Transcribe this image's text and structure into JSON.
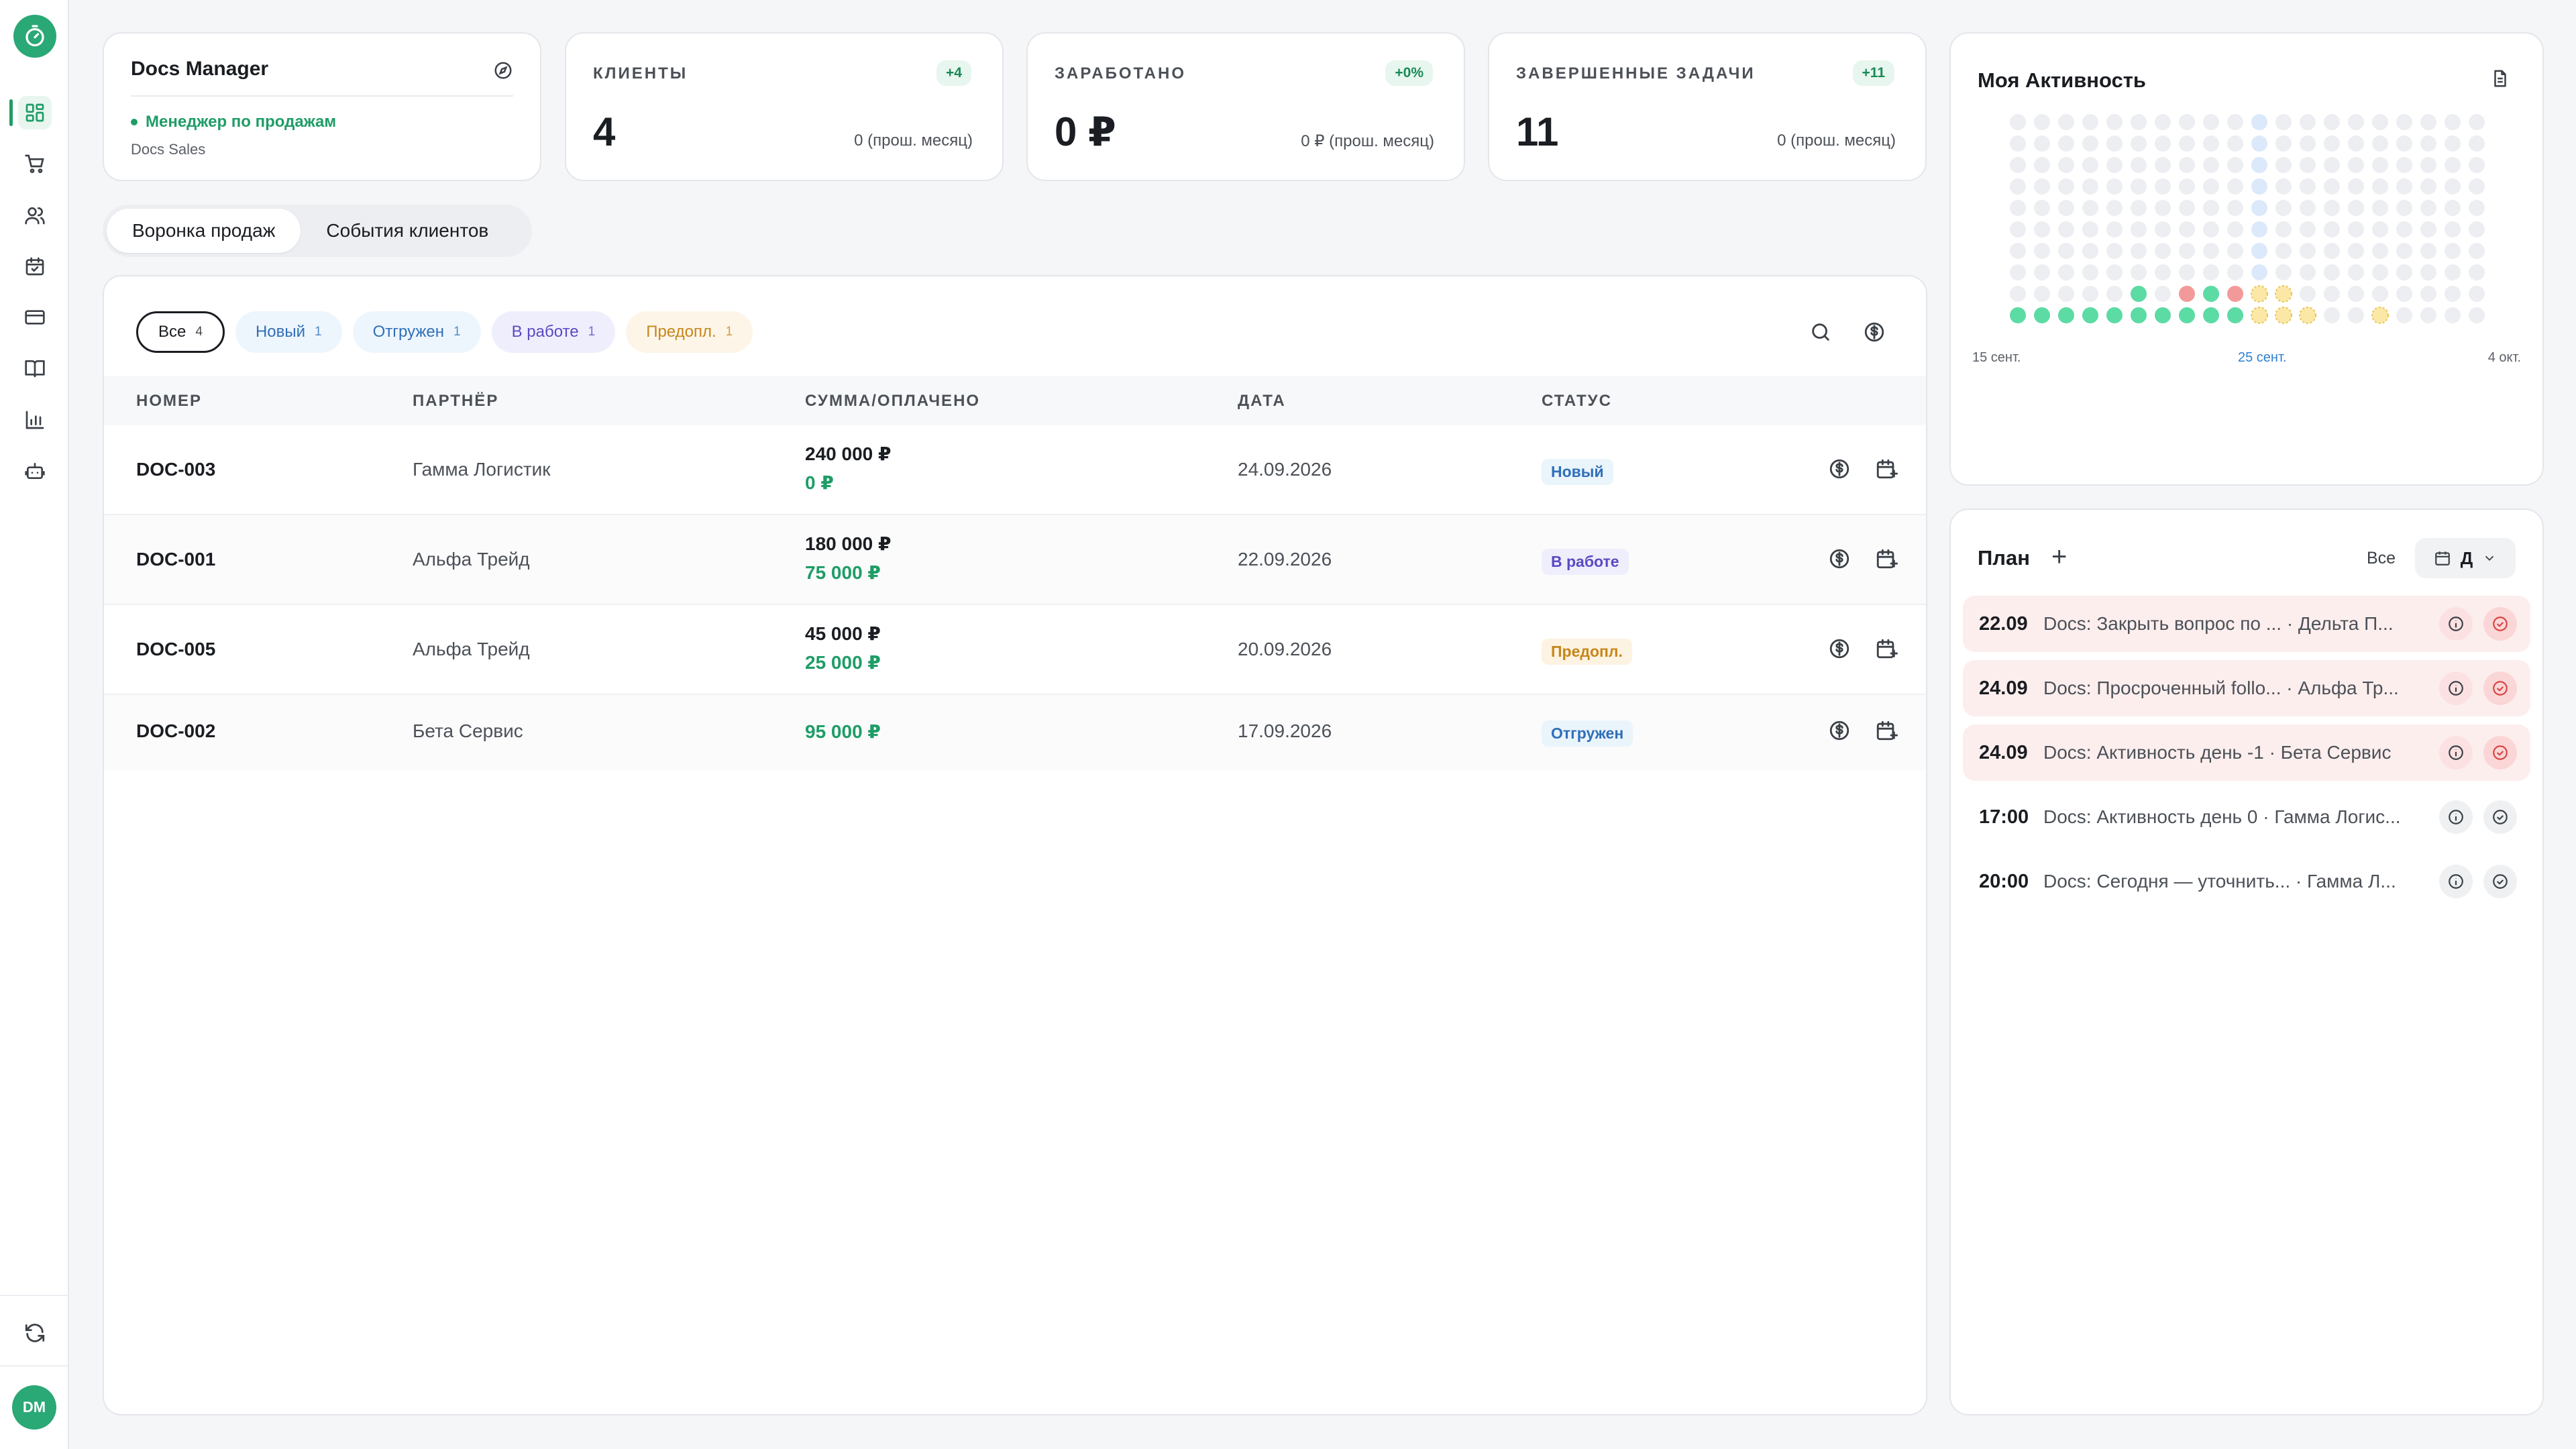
{
  "profile": {
    "name": "Docs Manager",
    "role": "Менеджер по продажам",
    "team": "Docs Sales"
  },
  "stats": [
    {
      "label": "КЛИЕНТЫ",
      "badge": "+4",
      "value": "4",
      "prev": "0 (прош. месяц)"
    },
    {
      "label": "ЗАРАБОТАНО",
      "badge": "+0%",
      "value": "0 ₽",
      "prev": "0 ₽ (прош. месяц)"
    },
    {
      "label": "ЗАВЕРШЕННЫЕ ЗАДАЧИ",
      "badge": "+11",
      "value": "11",
      "prev": "0 (прош. месяц)"
    }
  ],
  "tabs": {
    "funnel": "Воронка продаж",
    "events": "События клиентов"
  },
  "filters": [
    {
      "label": "Все",
      "count": "4"
    },
    {
      "label": "Новый",
      "count": "1"
    },
    {
      "label": "Отгружен",
      "count": "1"
    },
    {
      "label": "В работе",
      "count": "1"
    },
    {
      "label": "Предопл.",
      "count": "1"
    }
  ],
  "table": {
    "headers": {
      "number": "НОМЕР",
      "partner": "ПАРТНЁР",
      "sum": "СУММА/ОПЛАЧЕНО",
      "date": "ДАТА",
      "status": "СТАТУС"
    },
    "rows": [
      {
        "number": "DOC-003",
        "partner": "Гамма Логистик",
        "sum": "240 000 ₽",
        "paid": "0 ₽",
        "date": "24.09.2026",
        "status": "Новый"
      },
      {
        "number": "DOC-001",
        "partner": "Альфа Трейд",
        "sum": "180 000 ₽",
        "paid": "75 000 ₽",
        "date": "22.09.2026",
        "status": "В работе"
      },
      {
        "number": "DOC-005",
        "partner": "Альфа Трейд",
        "sum": "45 000 ₽",
        "paid": "25 000 ₽",
        "date": "20.09.2026",
        "status": "Предопл."
      },
      {
        "number": "DOC-002",
        "partner": "Бета Сервис",
        "sum": "",
        "paid": "95 000 ₽",
        "date": "17.09.2026",
        "status": "Отгружен"
      }
    ]
  },
  "activity": {
    "title": "Моя Активность",
    "dates": {
      "start": "15 сент.",
      "mid": "25 сент.",
      "end": "4 окт."
    },
    "highlight_col": 10,
    "bottom_row": [
      "done",
      "done",
      "done",
      "done",
      "done",
      "done",
      "done",
      "done",
      "done",
      "done",
      "pending",
      "pending",
      "pending",
      "empty",
      "empty",
      "pending",
      "empty",
      "empty",
      "empty",
      "empty"
    ],
    "second_row": [
      "empty",
      "empty",
      "empty",
      "empty",
      "empty",
      "done",
      "empty",
      "missed",
      "done",
      "missed",
      "pending",
      "pending",
      "empty",
      "empty",
      "empty",
      "empty",
      "empty",
      "empty",
      "empty",
      "empty"
    ],
    "colors": {
      "done": "#5cdba4",
      "missed": "#f29a9a",
      "pending": "#fbe7a6",
      "empty": "#eceef1",
      "highlight": "#dbe9fb"
    }
  },
  "plan": {
    "title": "План",
    "filter": "Все",
    "view": "Д",
    "items": [
      {
        "time": "22.09",
        "text": "Docs: Закрыть вопрос по ... · Дельта П...",
        "overdue": true
      },
      {
        "time": "24.09",
        "text": "Docs: Просроченный follo... · Альфа Тр...",
        "overdue": true
      },
      {
        "time": "24.09",
        "text": "Docs: Активность день -1 · Бета Сервис",
        "overdue": true
      },
      {
        "time": "17:00",
        "text": "Docs: Активность день 0 · Гамма Логис...",
        "overdue": false
      },
      {
        "time": "20:00",
        "text": "Docs: Сегодня — уточнить... · Гамма Л...",
        "overdue": false
      }
    ]
  }
}
